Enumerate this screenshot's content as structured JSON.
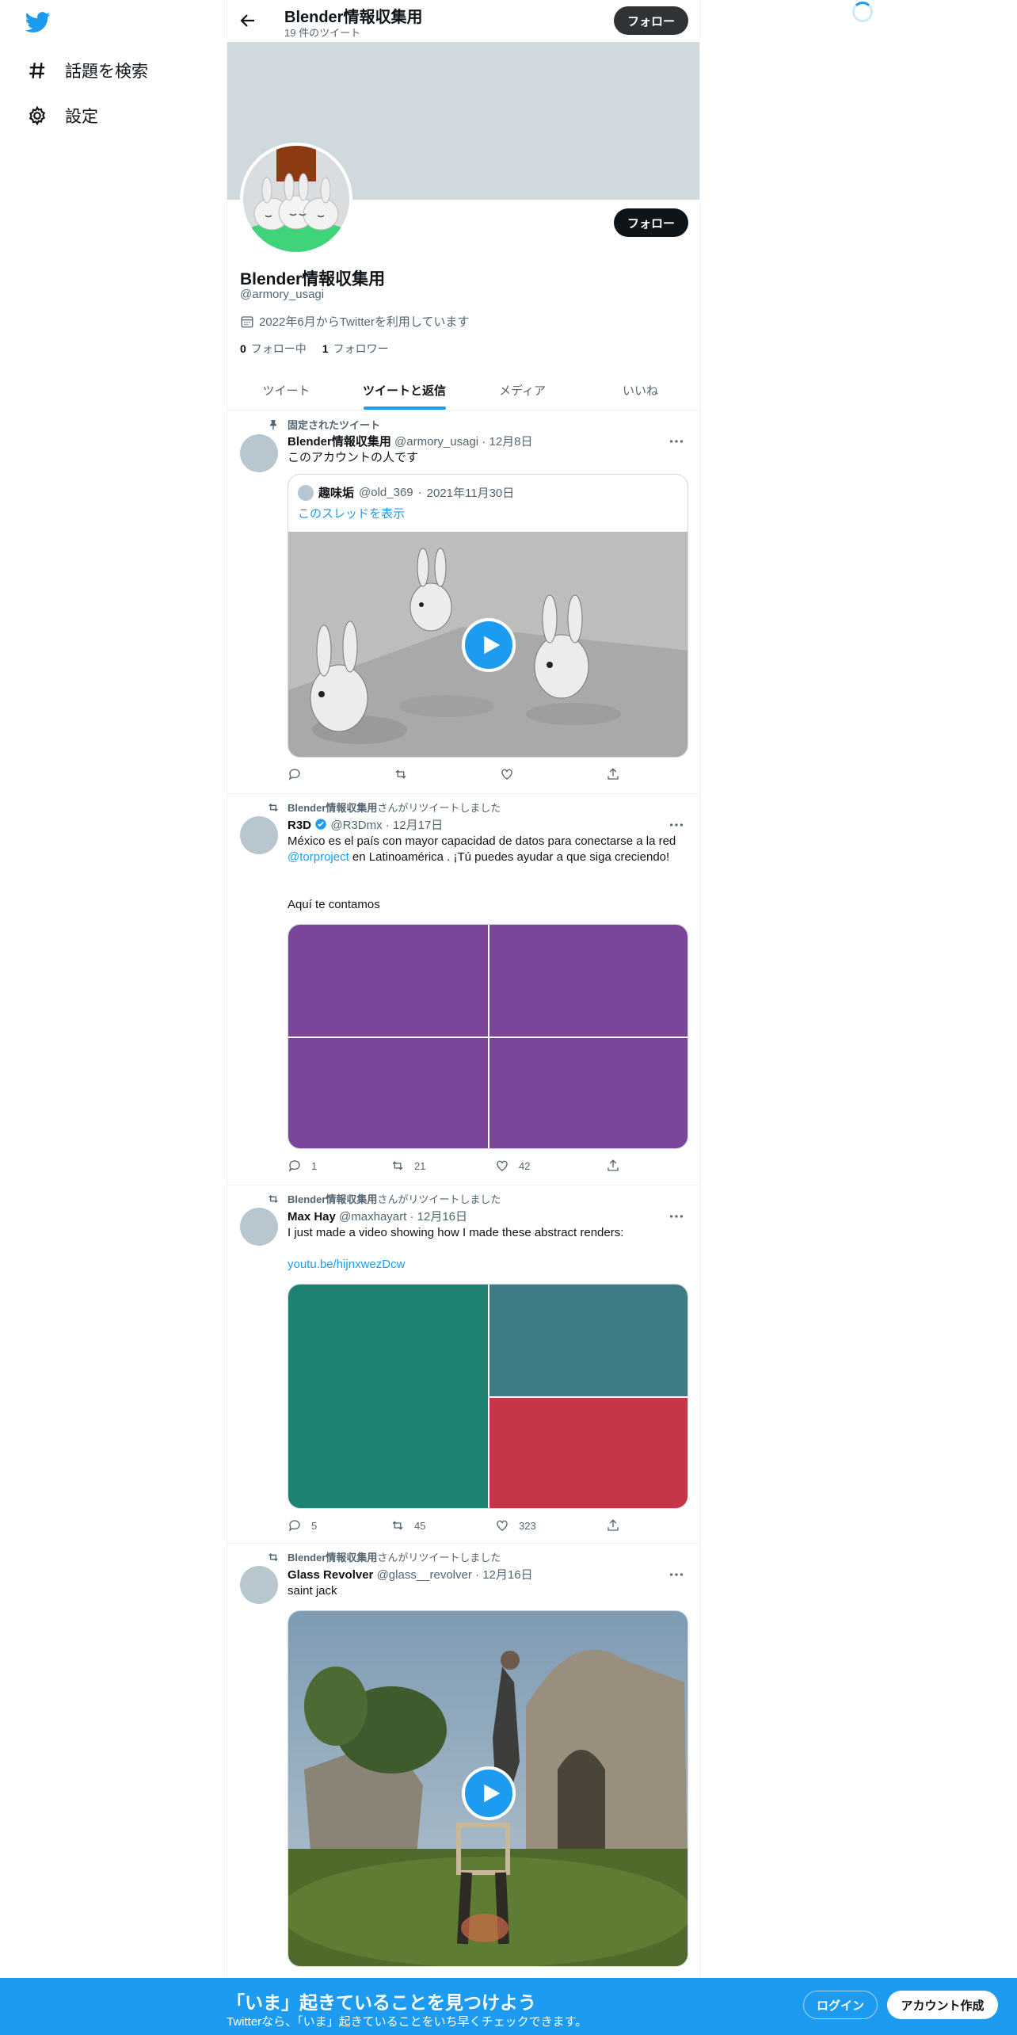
{
  "colors": {
    "accent": "#1d9bf0",
    "text": "#0f1419",
    "secondary": "#536471",
    "banner": "#cfd9de"
  },
  "nav": {
    "explore_label": "話題を検索",
    "settings_label": "設定"
  },
  "header": {
    "title": "Blender情報収集用",
    "subtitle": "19 件のツイート",
    "follow_label": "フォロー"
  },
  "profile": {
    "name": "Blender情報収集用",
    "handle": "@armory_usagi",
    "joined": "2022年6月からTwitterを利用しています",
    "following_count": "0",
    "following_label": "フォロー中",
    "followers_count": "1",
    "followers_label": "フォロワー",
    "follow_label": "フォロー"
  },
  "tabs": [
    {
      "label": "ツイート",
      "active": false
    },
    {
      "label": "ツイートと返信",
      "active": true
    },
    {
      "label": "メディア",
      "active": false
    },
    {
      "label": "いいね",
      "active": false
    }
  ],
  "tweets": [
    {
      "context": "固定されたツイート",
      "name": "Blender情報収集用",
      "handle": "@armory_usagi",
      "date": "12月8日",
      "text": "このアカウントの人です",
      "quote": {
        "name": "趣味垢",
        "handle": "@old_369",
        "date": "2021年11月30日",
        "thread_link": "このスレッドを表示"
      },
      "replies": "",
      "retweets": "",
      "likes": ""
    },
    {
      "context_name": "Blender情報収集用",
      "context_suffix": "さんがリツイートしました",
      "name": "R3D",
      "handle": "@R3Dmx",
      "date": "12月17日",
      "text_1": "México es el país con mayor capacidad de datos para conectarse a la red",
      "mention": "@torproject",
      "text_2": " en Latinoamérica          . ¡Tú puedes ayudar a que siga creciendo!",
      "text_3": "Aquí te contamos",
      "replies": "1",
      "retweets": "21",
      "likes": "42"
    },
    {
      "context_name": "Blender情報収集用",
      "context_suffix": "さんがリツイートしました",
      "name": "Max Hay",
      "handle": "@maxhayart",
      "date": "12月16日",
      "text": "I just made a video showing how I made these abstract renders:",
      "link": "youtu.be/hijnxwezDcw",
      "replies": "5",
      "retweets": "45",
      "likes": "323"
    },
    {
      "context_name": "Blender情報収集用",
      "context_suffix": "さんがリツイートしました",
      "name": "Glass Revolver",
      "handle": "@glass__revolver",
      "date": "12月16日",
      "text": "saint jack"
    }
  ],
  "bottom": {
    "title": "「いま」起きていることを見つけよう",
    "subtitle": "Twitterなら、「いま」起きていることをいち早くチェックできます。",
    "login_label": "ログイン",
    "signup_label": "アカウント作成"
  },
  "icons": [
    "twitter-logo-icon",
    "hashtag-icon",
    "gear-icon",
    "back-arrow-icon",
    "calendar-icon",
    "pin-icon",
    "retweet-icon",
    "reply-icon",
    "like-icon",
    "share-icon",
    "more-icon",
    "verified-icon",
    "play-icon"
  ]
}
